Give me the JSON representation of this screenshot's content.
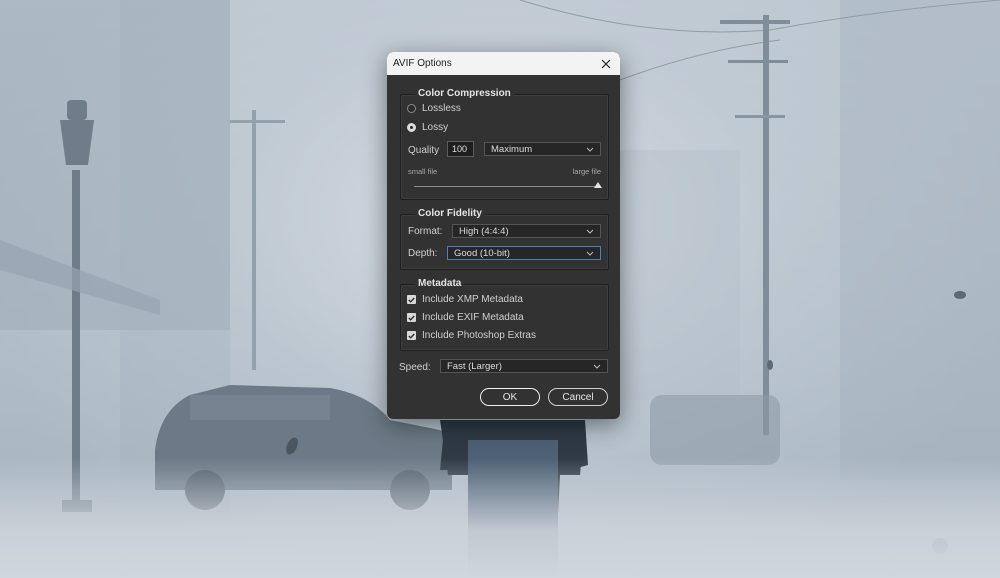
{
  "dialog": {
    "title": "AVIF Options",
    "color_compression": {
      "title": "Color Compression",
      "options": [
        {
          "label": "Lossless",
          "checked": false
        },
        {
          "label": "Lossy",
          "checked": true
        }
      ],
      "quality_label": "Quality",
      "quality_value": "100",
      "quality_preset": "Maximum",
      "small_file_label": "small file",
      "large_file_label": "large file",
      "slider_fraction": 1.0
    },
    "color_fidelity": {
      "title": "Color Fidelity",
      "format_label": "Format:",
      "format_value": "High (4:4:4)",
      "depth_label": "Depth:",
      "depth_value": "Good (10-bit)"
    },
    "metadata": {
      "title": "Metadata",
      "items": [
        {
          "label": "Include XMP Metadata",
          "checked": true
        },
        {
          "label": "Include EXIF Metadata",
          "checked": true
        },
        {
          "label": "Include Photoshop Extras",
          "checked": true
        }
      ]
    },
    "speed_label": "Speed:",
    "speed_value": "Fast (Larger)",
    "ok_label": "OK",
    "cancel_label": "Cancel"
  },
  "colors": {
    "dialog_bg": "#323232",
    "titlebar_bg": "#f3f3f3",
    "focus_blue": "#4a7fc9"
  },
  "icons": {
    "close": "close-icon",
    "chevron": "chevron-down-icon",
    "check": "checkmark-icon"
  }
}
